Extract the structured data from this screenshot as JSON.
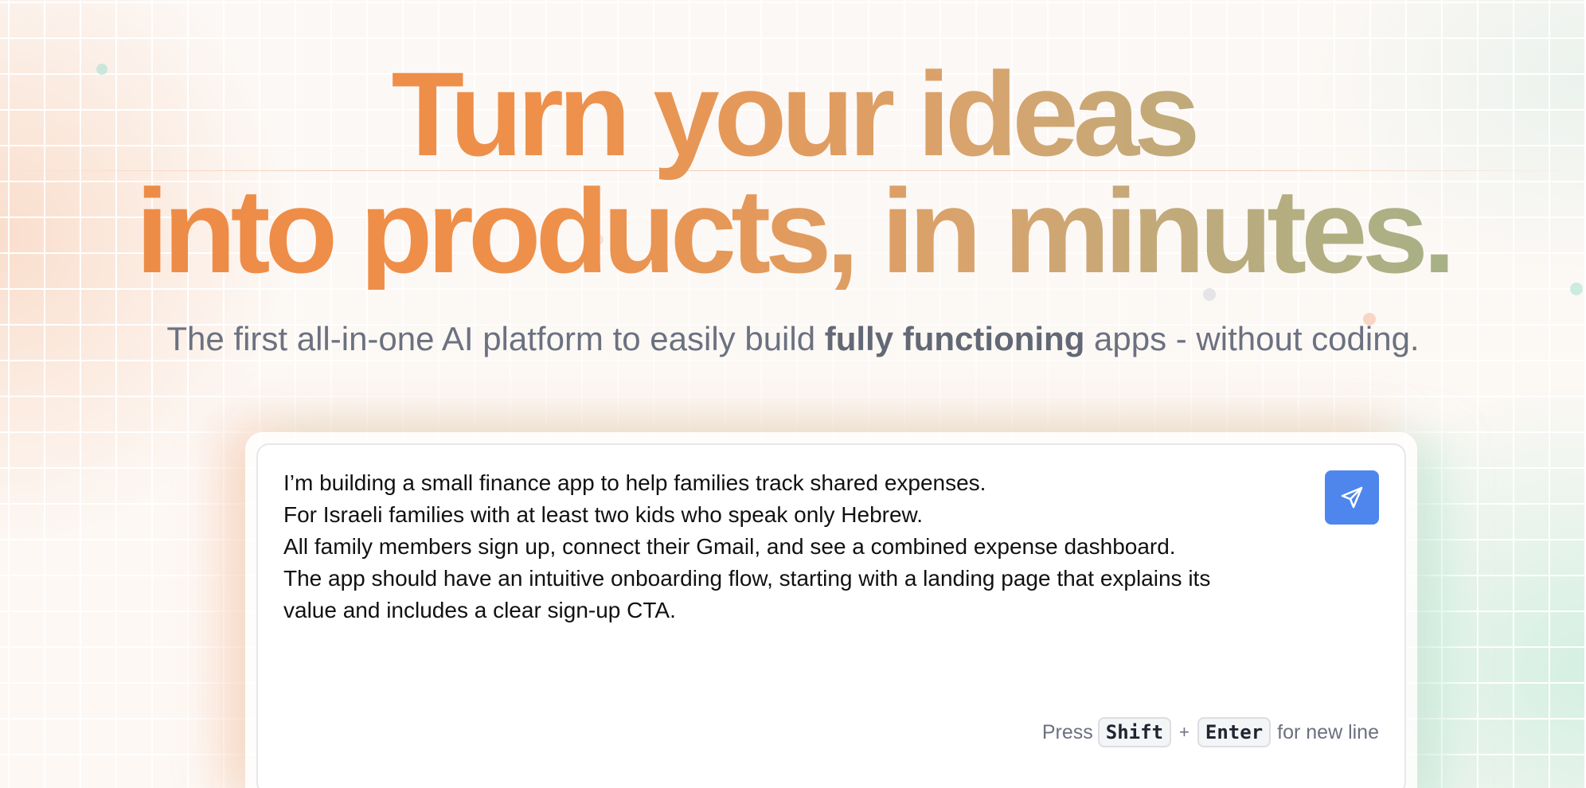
{
  "hero": {
    "headline_line1": "Turn your ideas",
    "headline_line2": "into products, in minutes.",
    "subtitle_before": "The first all-in-one AI platform to easily build ",
    "subtitle_bold": "fully functioning",
    "subtitle_after": " apps - without coding."
  },
  "prompt": {
    "value": "I’m building a small finance app to help families track shared expenses.\nFor Israeli families with at least two kids who speak only Hebrew.\nAll family members sign up, connect their Gmail, and see a combined expense dashboard.\nThe app should have an intuitive onboarding flow, starting with a landing page that explains its\nvalue and includes a clear sign-up CTA.",
    "send_icon": "send-icon",
    "hint_prefix": "Press",
    "hint_key1": "Shift",
    "hint_plus": "+",
    "hint_key2": "Enter",
    "hint_suffix": "for new line"
  },
  "colors": {
    "accent_orange": "#ed8a45",
    "accent_sage": "#9cb48a",
    "send_button": "#4e86ee",
    "subtitle_text": "#6b7180"
  }
}
